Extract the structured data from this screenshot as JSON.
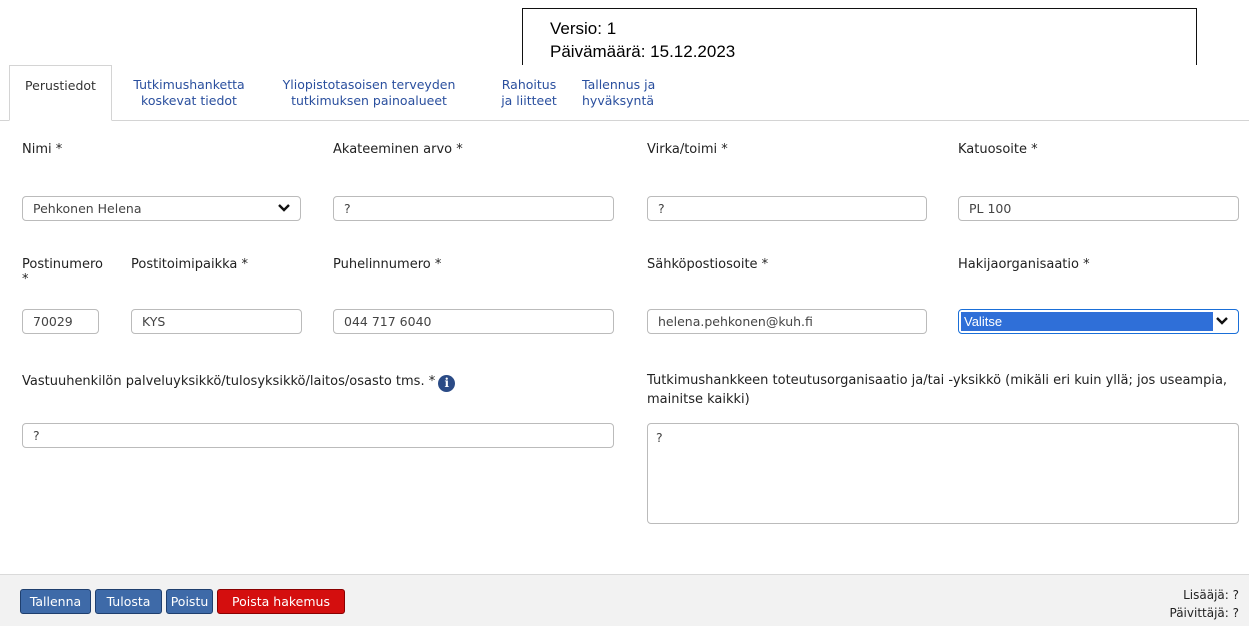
{
  "header_box": {
    "version": "Versio: 1",
    "date": "Päivämäärä: 15.12.2023"
  },
  "tabs": [
    {
      "line1": "Perustiedot",
      "line2": ""
    },
    {
      "line1": "Tutkimushanketta",
      "line2": "koskevat tiedot"
    },
    {
      "line1": "Yliopistotasoisen terveyden",
      "line2": "tutkimuksen painoalueet"
    },
    {
      "line1": "Rahoitus",
      "line2": "ja liitteet"
    },
    {
      "line1": "Tallennus ja",
      "line2": "hyväksyntä"
    }
  ],
  "form": {
    "nimi": {
      "label": "Nimi *",
      "value": "Pehkonen Helena"
    },
    "akateeminen_arvo": {
      "label": "Akateeminen arvo *",
      "value": "?"
    },
    "virka": {
      "label": "Virka/toimi *",
      "value": "?"
    },
    "katuosoite": {
      "label": "Katuosoite *",
      "value": "PL 100"
    },
    "postinumero": {
      "label": "Postinumero",
      "label_star": "*",
      "value": "70029"
    },
    "postitoimipaikka": {
      "label": "Postitoimipaikka *",
      "value": "KYS"
    },
    "puhelin": {
      "label": "Puhelinnumero *",
      "value": "044 717 6040"
    },
    "sahkoposti": {
      "label": "Sähköpostiosoite *",
      "value": "helena.pehkonen@kuh.fi"
    },
    "hakijaorganisaatio": {
      "label": "Hakijaorganisaatio *",
      "value": "Valitse"
    },
    "vastuuyksikko": {
      "label": "Vastuuhenkilön palveluyksikkö/tulosyksikkö/laitos/osasto tms. *",
      "value": "?"
    },
    "toteutusorganisaatio": {
      "label_line1": "Tutkimushankkeen toteutusorganisaatio ja/tai -yksikkö (mikäli eri kuin yllä; jos useampia,",
      "label_line2": "mainitse kaikki)",
      "value": "?"
    }
  },
  "footer": {
    "buttons": {
      "save": "Tallenna",
      "print": "Tulosta",
      "exit": "Poistu",
      "delete": "Poista hakemus"
    },
    "added_by": "Lisääjä: ?",
    "updated_by": "Päivittäjä: ?"
  },
  "colors": {
    "link": "#2a4f9e",
    "primary_button": "#3e6aa8",
    "danger_button": "#d40e0e",
    "select_highlight": "#2f6fd8"
  }
}
